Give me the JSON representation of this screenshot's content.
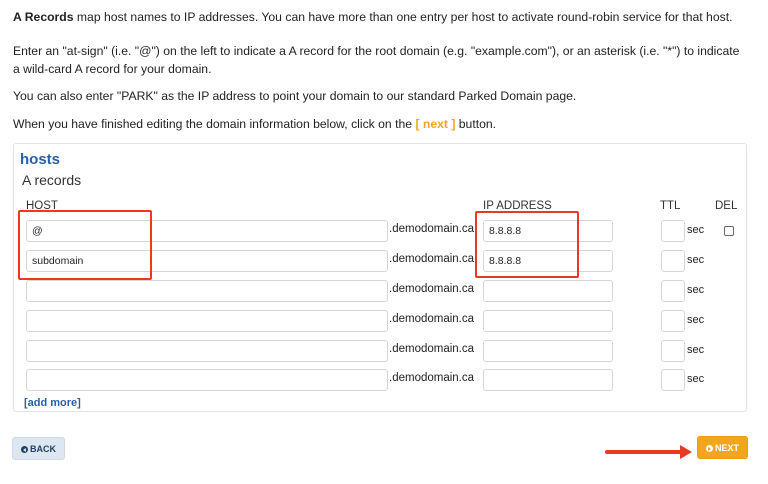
{
  "intro": {
    "line1_bold": "A Records",
    "line1_rest": " map host names to IP addresses. You can have more than one entry per host to activate round-robin service for that host.",
    "line2": "Enter an \"at-sign\" (i.e. \"@\") on the left to indicate a A record for the root domain (e.g. \"example.com\"), or an asterisk (i.e. \"*\") to indicate a wild-card A record for your domain.",
    "line3": "You can also enter \"PARK\" as the IP address to point your domain to our standard Parked Domain page.",
    "line4_before": "When you have finished editing the domain information below, click on the ",
    "line4_link": "[ next ]",
    "line4_after": " button."
  },
  "panel": {
    "title": "hosts",
    "subtitle": "A records",
    "columns": {
      "host": "HOST",
      "ip": "IP ADDRESS",
      "ttl": "TTL",
      "del": "DEL"
    },
    "domain_suffix": ".demodomain.ca",
    "sec_label": "sec",
    "rows": [
      {
        "host": "@",
        "ip": "8.8.8.8",
        "has_delete": true
      },
      {
        "host": "subdomain",
        "ip": "8.8.8.8",
        "has_delete": false
      },
      {
        "host": "",
        "ip": "",
        "has_delete": false
      },
      {
        "host": "",
        "ip": "",
        "has_delete": false
      },
      {
        "host": "",
        "ip": "",
        "has_delete": false
      },
      {
        "host": "",
        "ip": "",
        "has_delete": false
      }
    ],
    "add_more": "[add more]"
  },
  "buttons": {
    "back": "BACK",
    "next": "NEXT"
  },
  "colors": {
    "accent_blue": "#2a5ea6",
    "accent_orange": "#f2a71b",
    "annotation_red": "#e43b22"
  }
}
